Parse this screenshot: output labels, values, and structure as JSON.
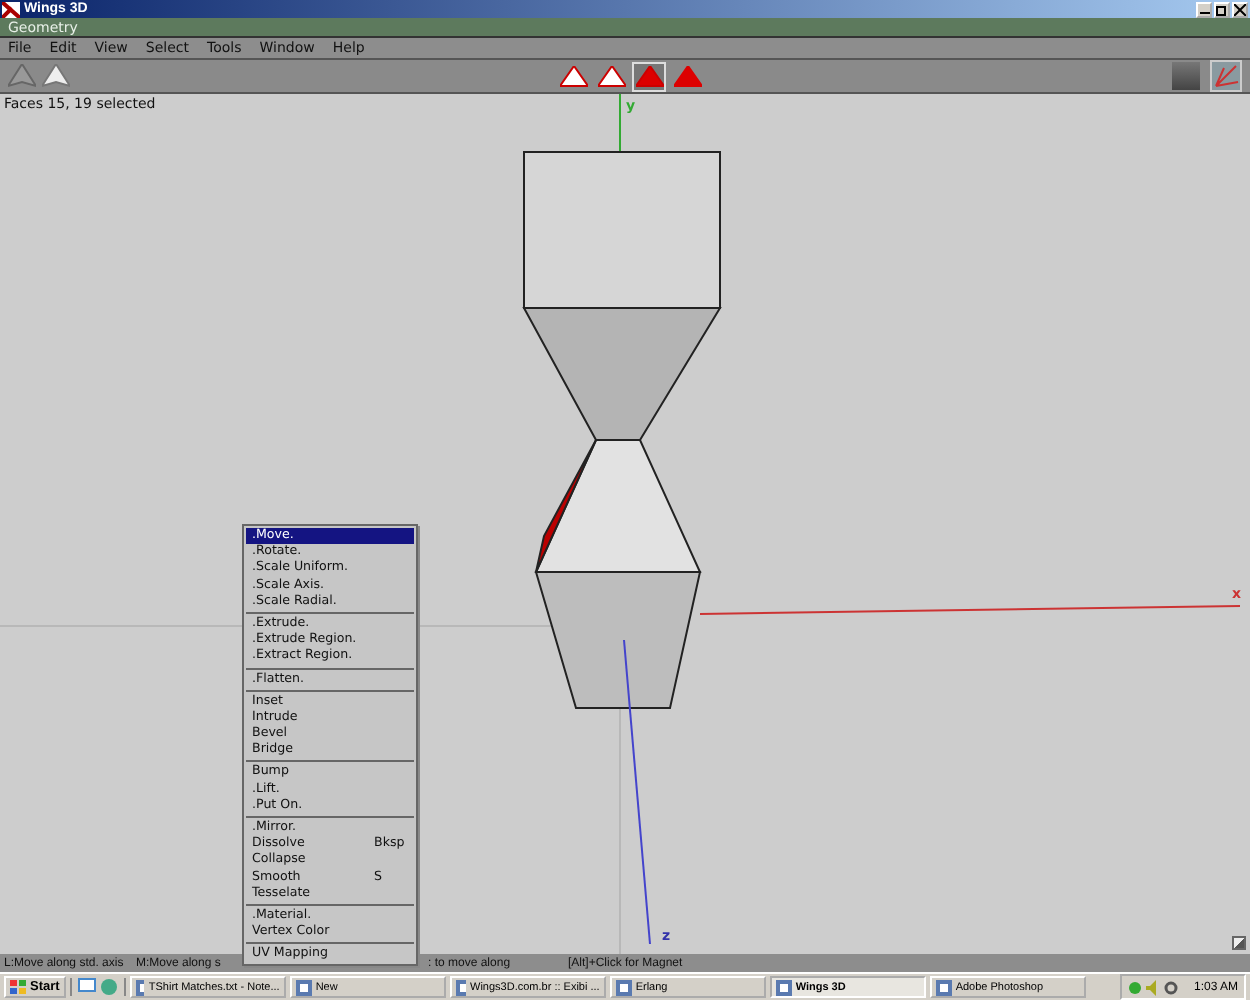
{
  "window": {
    "title": "Wings 3D"
  },
  "geometry_bar": {
    "title": "Geometry"
  },
  "menu_bar": [
    "File",
    "Edit",
    "View",
    "Select",
    "Tools",
    "Window",
    "Help"
  ],
  "select_modes": [
    {
      "selected": false
    },
    {
      "selected": false
    },
    {
      "selected": true
    },
    {
      "selected": false
    }
  ],
  "viewport": {
    "info": "Faces 15, 19 selected",
    "axes": [
      "y",
      "x",
      "z"
    ]
  },
  "context_menu": [
    {
      "kind": "item",
      "label": ".Move.",
      "selected": true
    },
    {
      "kind": "item",
      "label": ".Rotate.",
      "selected": false
    },
    {
      "kind": "item",
      "label": ".Scale Uniform.",
      "selected": false
    },
    {
      "kind": "item",
      "label": ".Scale Axis.",
      "selected": false
    },
    {
      "kind": "item",
      "label": ".Scale Radial.",
      "selected": false
    },
    {
      "kind": "separator"
    },
    {
      "kind": "item",
      "label": ".Extrude.",
      "selected": false
    },
    {
      "kind": "item",
      "label": ".Extrude Region.",
      "selected": false
    },
    {
      "kind": "item",
      "label": ".Extract Region.",
      "selected": false
    },
    {
      "kind": "separator"
    },
    {
      "kind": "item",
      "label": ".Flatten.",
      "selected": false
    },
    {
      "kind": "separator"
    },
    {
      "kind": "item",
      "label": "Inset",
      "selected": false
    },
    {
      "kind": "item",
      "label": "Intrude",
      "selected": false
    },
    {
      "kind": "item",
      "label": "Bevel",
      "selected": false
    },
    {
      "kind": "item",
      "label": "Bridge",
      "selected": false
    },
    {
      "kind": "separator"
    },
    {
      "kind": "item",
      "label": "Bump",
      "selected": false
    },
    {
      "kind": "item",
      "label": ".Lift.",
      "selected": false
    },
    {
      "kind": "item",
      "label": ".Put On.",
      "selected": false
    },
    {
      "kind": "separator"
    },
    {
      "kind": "item",
      "label": ".Mirror.",
      "selected": false
    },
    {
      "kind": "item",
      "label": "Dissolve",
      "shortcut": "Bksp",
      "selected": false
    },
    {
      "kind": "item",
      "label": "Collapse",
      "selected": false
    },
    {
      "kind": "item",
      "label": "Smooth",
      "shortcut": "S",
      "selected": false
    },
    {
      "kind": "item",
      "label": "Tesselate",
      "selected": false
    },
    {
      "kind": "separator"
    },
    {
      "kind": "item",
      "label": ".Material.",
      "selected": false
    },
    {
      "kind": "item",
      "label": "Vertex Color",
      "selected": false
    },
    {
      "kind": "separator"
    },
    {
      "kind": "item",
      "label": "UV Mapping",
      "selected": false
    }
  ],
  "status_bar": [
    "L:Move along std. axis",
    "M:Move along s",
    ": to move along",
    "[Alt]+Click for Magnet"
  ],
  "taskbar": {
    "start": "Start",
    "tasks": [
      {
        "label": "TShirt Matches.txt - Note...",
        "selected": false
      },
      {
        "label": "New",
        "selected": false
      },
      {
        "label": "Wings3D.com.br :: Exibi ...",
        "selected": false
      },
      {
        "label": "Erlang",
        "selected": false
      },
      {
        "label": "Wings 3D",
        "selected": true
      },
      {
        "label": "Adobe Photoshop",
        "selected": false
      }
    ],
    "clock": "1:03 AM"
  }
}
